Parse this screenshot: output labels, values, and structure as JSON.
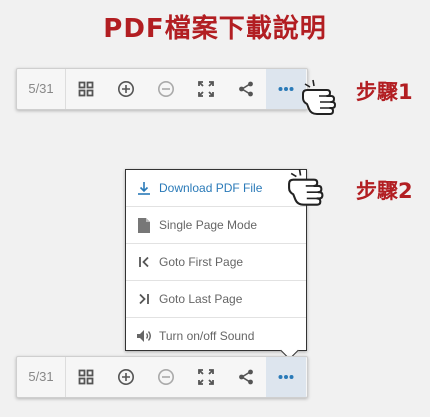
{
  "title": "PDF檔案下載說明",
  "steps": {
    "step1": "步驟1",
    "step2": "步驟2"
  },
  "toolbar": {
    "page_indicator": "5/31",
    "buttons": [
      "grid-icon",
      "zoom-in-icon",
      "zoom-out-icon",
      "fullscreen-icon",
      "share-icon",
      "more-icon"
    ],
    "active_button": "more-icon"
  },
  "menu": {
    "items": [
      {
        "label": "Download PDF File",
        "icon": "download-icon",
        "active": true
      },
      {
        "label": "Single Page Mode",
        "icon": "document-icon"
      },
      {
        "label": "Goto First Page",
        "icon": "first-page-icon"
      },
      {
        "label": "Goto Last Page",
        "icon": "last-page-icon"
      },
      {
        "label": "Turn on/off Sound",
        "icon": "sound-icon"
      }
    ]
  },
  "colors": {
    "accent_red": "#b21e22",
    "active_blue": "#2a7ab8",
    "toolbar_bg": "#f6f6f6"
  }
}
